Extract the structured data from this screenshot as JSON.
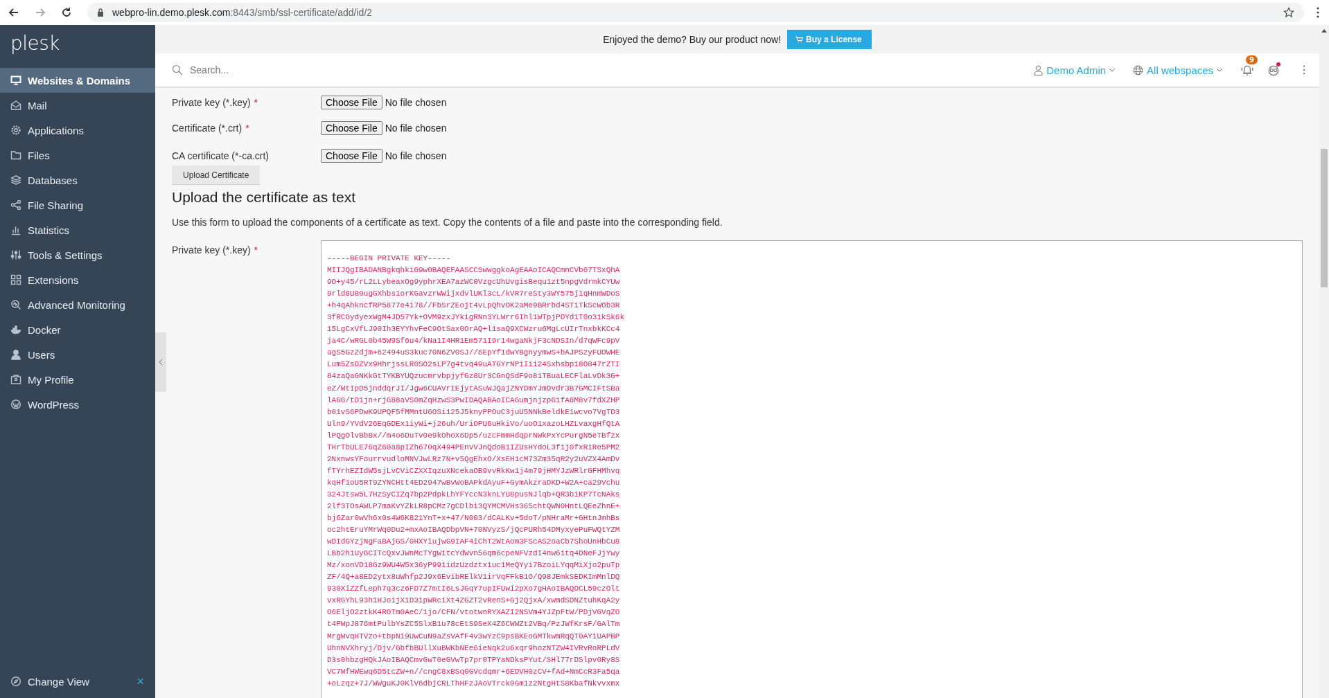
{
  "browser": {
    "url_host": "webpro-lin.demo.plesk.com",
    "url_path": ":8443/smb/ssl-certificate/add/id/2"
  },
  "sidebar": {
    "logo": "plesk",
    "items": [
      {
        "label": "Websites & Domains",
        "kind": "monitor",
        "selected": true
      },
      {
        "label": "Mail",
        "kind": "mail",
        "selected": false
      },
      {
        "label": "Applications",
        "kind": "gear",
        "selected": false
      },
      {
        "label": "Files",
        "kind": "folder",
        "selected": false
      },
      {
        "label": "Databases",
        "kind": "layers",
        "selected": false
      },
      {
        "label": "File Sharing",
        "kind": "share",
        "selected": false
      },
      {
        "label": "Statistics",
        "kind": "chart",
        "selected": false
      },
      {
        "label": "Tools & Settings",
        "kind": "sliders",
        "selected": false
      },
      {
        "label": "Extensions",
        "kind": "blocks",
        "selected": false
      },
      {
        "label": "Advanced Monitoring",
        "kind": "monitoring",
        "selected": false
      },
      {
        "label": "Docker",
        "kind": "whale",
        "selected": false
      },
      {
        "label": "Users",
        "kind": "user",
        "selected": false
      },
      {
        "label": "My Profile",
        "kind": "profile",
        "selected": false
      },
      {
        "label": "WordPress",
        "kind": "wordpress",
        "selected": false
      }
    ],
    "footer": {
      "label": "Change View",
      "close": "×"
    }
  },
  "promo": {
    "text": "Enjoyed the demo? Buy our product now!",
    "button": "Buy a License"
  },
  "header": {
    "search_placeholder": "Search...",
    "user": "Demo Admin",
    "webspace": "All webspaces",
    "notifications": "9"
  },
  "file_rows": [
    {
      "label": "Private key (*.key)",
      "required_mark": "*",
      "button": "Choose File",
      "status": "No file chosen"
    },
    {
      "label": "Certificate (*.crt)",
      "required_mark": "*",
      "button": "Choose File",
      "status": "No file chosen"
    },
    {
      "label": "CA certificate (*-ca.crt)",
      "button": "Choose File",
      "status": "No file chosen"
    }
  ],
  "upload_button": "Upload Certificate",
  "text_section": {
    "heading": "Upload the certificate as text",
    "description": "Use this form to upload the components of a certificate as text. Copy the contents of a file and paste into the corresponding field.",
    "field": {
      "label": "Private key (*.key)",
      "required_mark": "*",
      "value_lines": [
        "-----BEGIN PRIVATE KEY-----",
        "MIIJQgIBADANBgkqhkiG9w0BAQEFAASCCSwwggkoAgEAAoICAQCmnCVb07TSxQhA",
        "9O+y45/rL2LLybeaxOg9yphrXEA7azWC0VzgcUhUvgisBequ1zt5npgVdrmkCYUw",
        "9rld8U80ugGXhbs1orKGavzrWWijxdvlUKl3cL/kVR7reSty3WY575j1qHnmWDoS",
        "+h4qAhkncfRP5877e4178//FbSrZEojt4vLpQhvOK2aMe9BRrbd4STiTkScWOb3R",
        "3fRCGydyexWgM4JD57Yk+OVM9zxJYkigRNn3YLWrr6Ihl1WTpjPDYd1T0o31kSk6k",
        "15LgCxVfLJ90Ih3EYYhvFeC9OtSax0OrAQ+l1saQ9XCWzru6MgLcUIrTnxbkKCc4",
        "ja4C/wRGL0b45W9Sf6u4/kNa1I4HR1Em571I9r14wgaNkjF3cNDSIn/d7qWFc9pV",
        "agS5GzZdjm+62494uS3kuc70N6ZV0SJ//6EpYf1dwYBgnyymwS+bAJPSzyFUOWHE",
        "Lum5ZsDZVx9HhrjssLR0SO2sLP7g4tvq49uATGYrNPiIii24Sxhsbp18O847rZTI",
        "84zaQaGNKkGtTYKBYUQzucmrvbpjyfGz8Ur3CGnQSdF9o81TBuaLECFlaLvDk3G+",
        "eZ/WtIpD5jnddqrJI/Jgw6CUAVrIEjytASuWJQajZNYDmYJmOvdr3B7GMCIFtSBa",
        "lAGG/tD1jn+rjG88aVS0mZqHzwS3PwIDAQABAoICAGumjnjzpG1fA8M8v7fdXZHP",
        "b01vS6PDwK9UPQF5fMMntU6OSi125J5knyPPOuC3juU5NNkBeldkE1wcvo7VgTD3",
        "Uln9/YVdV26EqGDEx1iyWi+j26uh/UriOPU6uHkiVo/uoO1xazoLHZLvaxgHfQtA",
        "lPQgOlvBbBx//m4o6DuTv0e9kOhoX6Dp5/uzcFmmHdqprNWkPxYcPurgN5eTBfzx",
        "THrTbULE76qZ60a8pIZh670qX494PEnvVJnQdoB1IZUsHYdoL3fij0fxRiRe5PM2",
        "2NxnwsYFourrvudloMNVJwLRz7N+v5QgEhxO/XsEH1cM73Zm35qR2y2uVZX4AmDv",
        "fTYrhEZIdW5sjLvCViCZXXIqzuXNcekaOB9vvRkKw1j4m79jHMYJzWRlrGFHMhvq",
        "kqHf1oU5RT9ZYNCHtt4ED2947wBvWoBAPkdAyuF+GymAkzraDKD+W2A+ca29Vchu",
        "324Jtsw5L7HzSyCIZq7bp2PdpkLhYFYccN3knLYU8pusNJlqb+QR3b1KP7TcNAks",
        "2lf3TOsAWLP7maKvYZkLR8pCMz7gCDlbi3QYMCMVHs365chtQWN0HntLQEeZhnE+",
        "bj6Zar0wVh6x0s4W6K821YnT+x+47/N003/dCALKv+5doT/pNHraMr+GHtnJmhBs",
        "oc2htEruYMrWq0Du2+mxAoIBAQDbpVN+70NVyzS/jQcPURh54DMyxyePuFWQtYZM",
        "wDIdGYzjNgFaBAjGS/0HXYiujwG9IAF4iChT2WtAom3FScAS2oaCb7ShoUnHbCu8",
        "LBb2h1UyGCITcQxvJWnMcTYgWitcYdWvn56qm6cpeNFVzdI4nw6itq4DNeFJjYwy",
        "Mz/xonVD18Gz9WU4W5x36yP991idzUzdztx1uc1MeQYyi7BzoiLYqqMiXjo2puTp",
        "ZF/4Q+a8ED2ytx8uWhfp2J9x6EvibRElkV1irVqFFkB1O/Q98JEmkSEDKImMnlDQ",
        "930XiZZfLeph7q3cz6FD7Z7mtI6LsJGqY7upIFUwi2pXo7gHAoIBAQDCL59czOlt",
        "vxRGYhL93h1HJoijX1D3ipWRciXt4ZGZT2vRenS+Gj2QjxA/xwmdSDNZtuhKqA2y",
        "O6EljO2ztkK4ROTm0AeC/1jo/CFN/vtotwnRYXAZI2NSVm4YJZpFtW/PDjVGVqZO",
        "t4PWpJ876mtPulbYsZC5SlxB1u78cEtS9SeX4Z6CWWZt2VBq/PzJWfKrsF/GAlTm",
        "MrgWvqHTVzo+tbpNi9UwCuN9aZsVAfF4v3wYzC9psBKEoGMTkwmRqQT0AYiUAPBP",
        "UhnNVXhryj/Djv/GbfbBUllXuBWKbNEe6ieNqk2u6xqr9hozNTZW4IVRvRoRPLdV",
        "D3s0hbzgHQkJAoIBAQCmvGwT0eGVwTp7pr0TPYaNDksPYut/SHl77rDSlpv0Ry8S",
        "VC7WfHWEwq6D5tcZW+n//cngC8xBSq0GVcdqmr+6EDVH0zCV+fAd+NmCcR3Fa5qa",
        "+oLzqz+7J/WWguKJ0KlV6dbjCRLThHFzJAoVTrck0Gm1z2NtgHtS8KbafNkvvxmx"
      ]
    }
  }
}
